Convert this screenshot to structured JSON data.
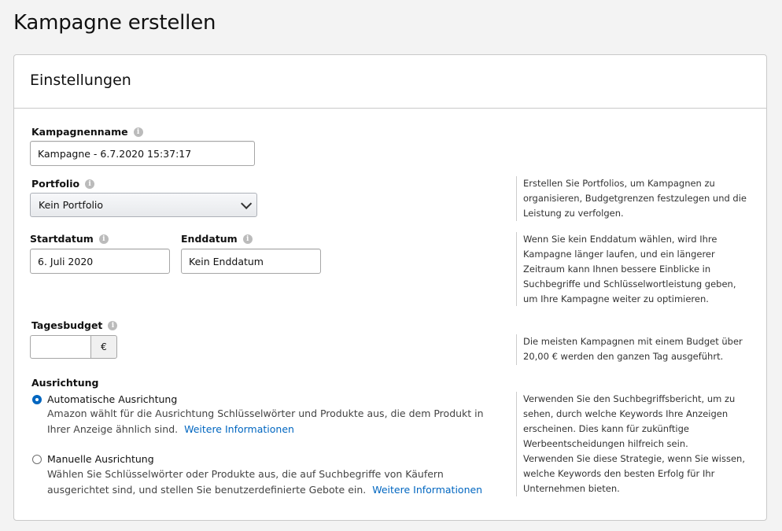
{
  "page": {
    "title": "Kampagne erstellen"
  },
  "card": {
    "title": "Einstellungen"
  },
  "campaign_name": {
    "label": "Kampagnenname",
    "value": "Kampagne - 6.7.2020 15:37:17"
  },
  "portfolio": {
    "label": "Portfolio",
    "selected": "Kein Portfolio",
    "help": "Erstellen Sie Portfolios, um Kampagnen zu organisieren, Budgetgrenzen festzulegen und die Leistung zu verfolgen."
  },
  "dates": {
    "start_label": "Startdatum",
    "start_value": "6. Juli 2020",
    "end_label": "Enddatum",
    "end_value": "Kein Enddatum",
    "help": "Wenn Sie kein Enddatum wählen, wird Ihre Kampagne länger laufen, und ein längerer Zeitraum kann Ihnen bessere Einblicke in Suchbegriffe und Schlüsselwortleistung geben, um Ihre Kampagne weiter zu optimieren."
  },
  "budget": {
    "label": "Tagesbudget",
    "value": "",
    "currency": "€",
    "help": "Die meisten Kampagnen mit einem Budget über 20,00 € werden den ganzen Tag ausgeführt."
  },
  "targeting": {
    "label": "Ausrichtung",
    "auto": {
      "label": "Automatische Ausrichtung",
      "desc": "Amazon wählt für die Ausrichtung Schlüsselwörter und Produkte aus, die dem Produkt in Ihrer Anzeige ähnlich sind.",
      "link": "Weitere Informationen",
      "help": "Verwenden Sie den Suchbegriffsbericht, um zu sehen, durch welche Keywords Ihre Anzeigen erscheinen. Dies kann für zukünftige Werbeentscheidungen hilfreich sein."
    },
    "manual": {
      "label": "Manuelle Ausrichtung",
      "desc": "Wählen Sie Schlüsselwörter oder Produkte aus, die auf Suchbegriffe von Käufern ausgerichtet sind, und stellen Sie benutzerdefinierte Gebote ein.",
      "link": "Weitere Informationen",
      "help": "Verwenden Sie diese Strategie, wenn Sie wissen, welche Keywords den besten Erfolg für Ihr Unternehmen bieten."
    },
    "selected": "auto"
  },
  "icons": {
    "info": "info-icon",
    "dropdown": "chevron-down-icon",
    "radio": "radio-icon"
  }
}
